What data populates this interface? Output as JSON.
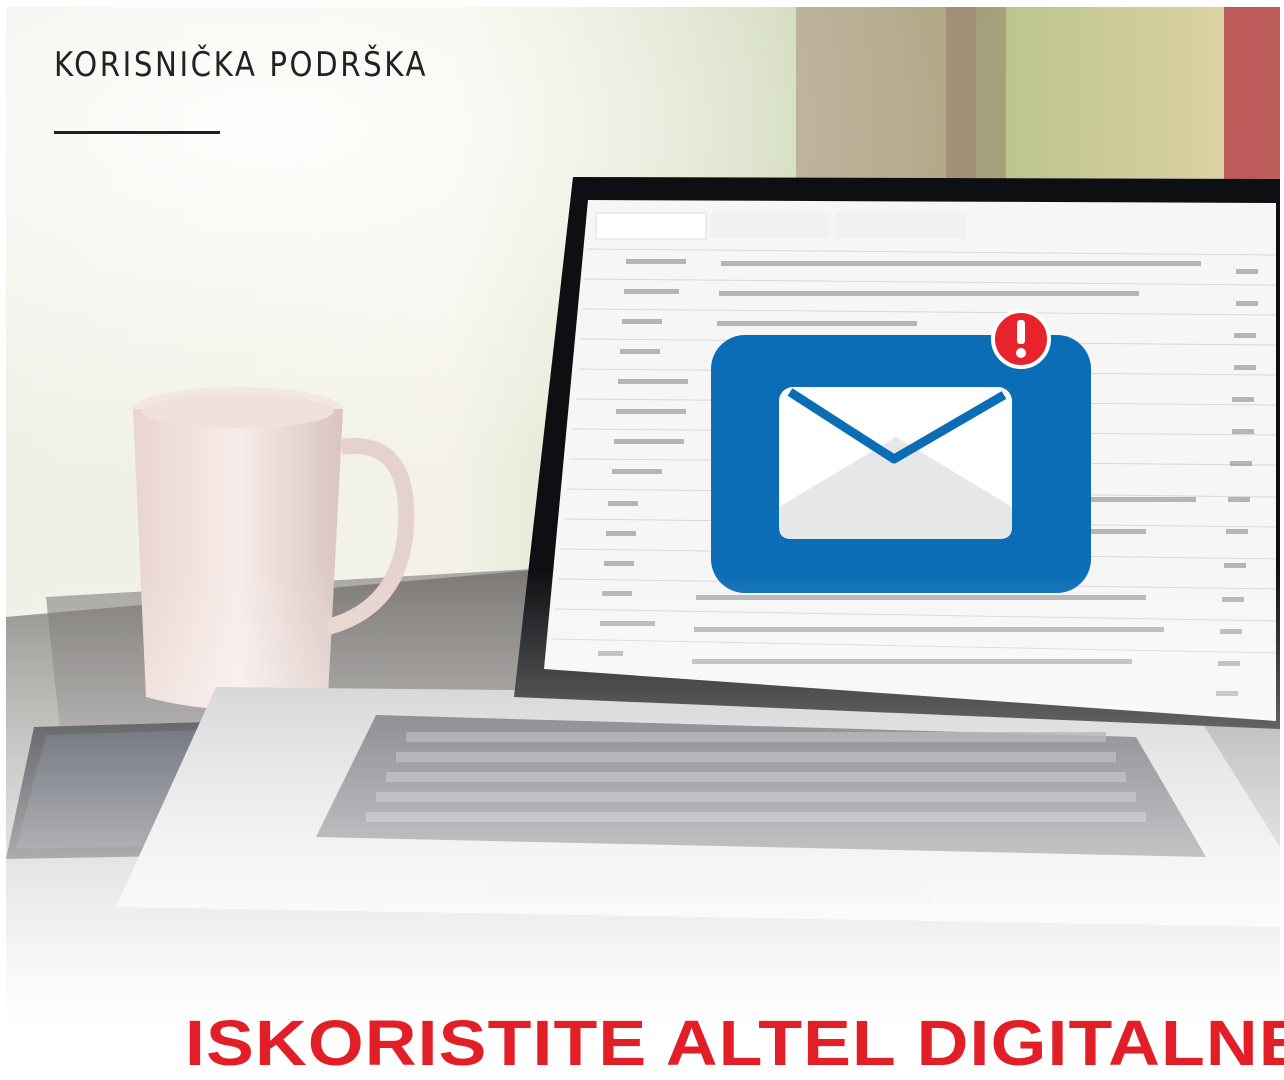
{
  "section_title": "KORISNIČKA PODRŠKA",
  "headline": "ISKORISTITE ALTEL DIGITALNE",
  "colors": {
    "headline": "#e21f26",
    "title": "#222222",
    "envelope_badge": "#0a6db5",
    "alert": "#e8232b"
  },
  "icons": [
    "envelope-icon",
    "alert-icon"
  ]
}
